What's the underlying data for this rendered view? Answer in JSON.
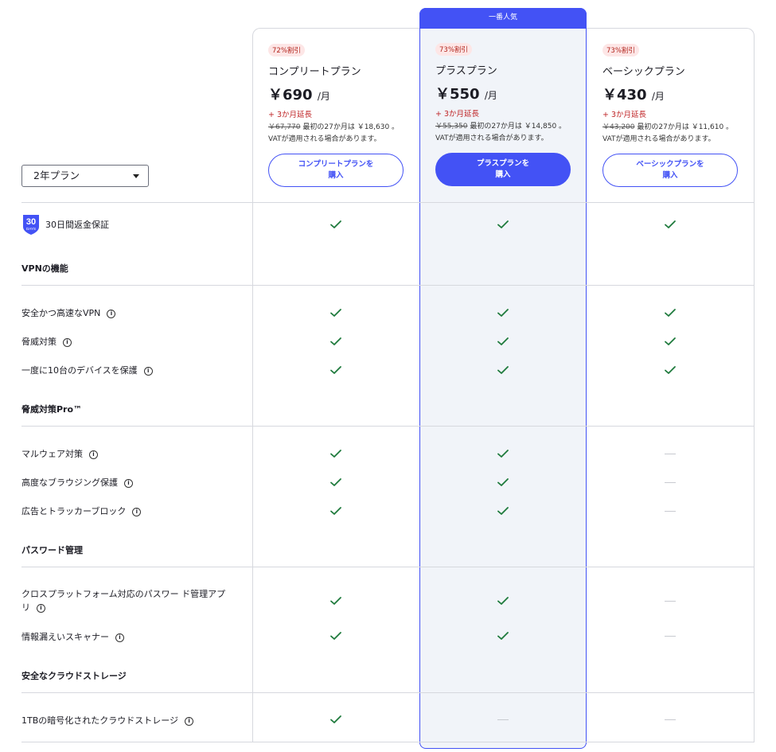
{
  "plus_banner": "一番人気",
  "plan_select": {
    "value": "2年プラン"
  },
  "plans": [
    {
      "badge": "72%割引",
      "name": "コンプリートプラン",
      "price": "￥690",
      "per": "/月",
      "extension": "+ 3か月延長",
      "old_price": "￥67,770",
      "note_a": "最初の27か月は ￥18,630 。",
      "note_b": "VATが適用される場合があります。",
      "buy_line1": "コンプリートプランを",
      "buy_line2": "購入"
    },
    {
      "badge": "73%割引",
      "name": "プラスプラン",
      "price": "￥550",
      "per": "/月",
      "extension": "+ 3か月延長",
      "old_price": "￥55,350",
      "note_a": "最初の27か月は ￥14,850 。",
      "note_b": "VATが適用される場合があります。",
      "buy_line1": "プラスプランを",
      "buy_line2": "購入"
    },
    {
      "badge": "73%割引",
      "name": "ベーシックプラン",
      "price": "￥430",
      "per": "/月",
      "extension": "+ 3か月延長",
      "old_price": "￥43,200",
      "note_a": "最初の27か月は ￥11,610 。",
      "note_b": "VATが適用される場合があります。",
      "buy_line1": "ベーシックプランを",
      "buy_line2": "購入"
    }
  ],
  "guarantee": {
    "days": "30",
    "unit": "DAYS",
    "label": "30日間返金保証"
  },
  "sections": {
    "vpn": "VPNの機能",
    "threat": "脅威対策Pro™",
    "password": "パスワード管理",
    "storage": "安全なクラウドストレージ"
  },
  "features": {
    "vpn_fast": "安全かつ高速なVPN",
    "threat_basic": "脅威対策",
    "devices": "一度に10台のデバイスを保護",
    "malware": "マルウェア対策",
    "browsing": "高度なブラウジング保護",
    "adblock": "広告とトラッカーブロック",
    "pw_app_1": "クロスプラットフォーム対応のパスワー ド管理アプ",
    "pw_app_2": "リ",
    "leak": "情報漏えいスキャナー",
    "cloud": "1TBの暗号化されたクラウドストレージ"
  },
  "info_glyph": "i",
  "colors": {
    "accent": "#4352f5",
    "check": "#1e7a3c",
    "discount": "#c0282a"
  }
}
